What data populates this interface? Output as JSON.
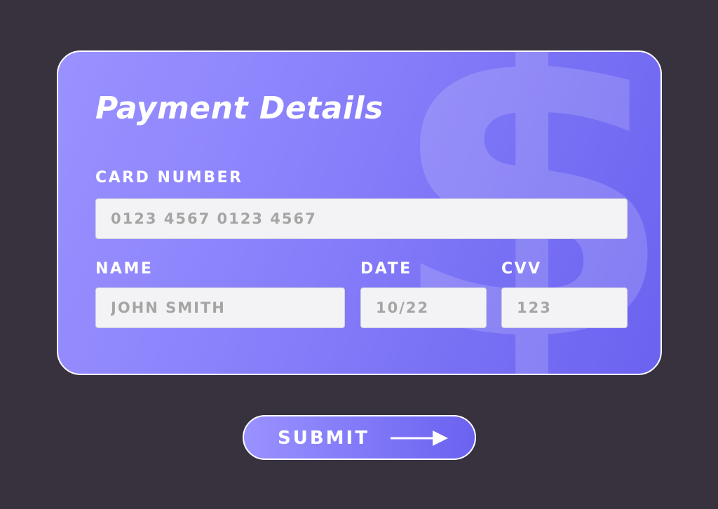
{
  "form": {
    "title": "Payment Details",
    "background_glyph": "$",
    "card_number": {
      "label": "CARD NUMBER",
      "placeholder": "0123 4567 0123 4567"
    },
    "name": {
      "label": "NAME",
      "placeholder": "JOHN SMITH"
    },
    "date": {
      "label": "DATE",
      "placeholder": "10/22"
    },
    "cvv": {
      "label": "CVV",
      "placeholder": "123"
    }
  },
  "submit": {
    "label": "SUBMIT",
    "icon": "arrow-right-icon"
  },
  "colors": {
    "page_background": "#37323e",
    "card_gradient_start": "#9a92ff",
    "card_gradient_end": "#6b62f0",
    "field_background": "#f3f3f5",
    "placeholder_text": "#a5a5a5",
    "label_text": "#ffffff"
  }
}
